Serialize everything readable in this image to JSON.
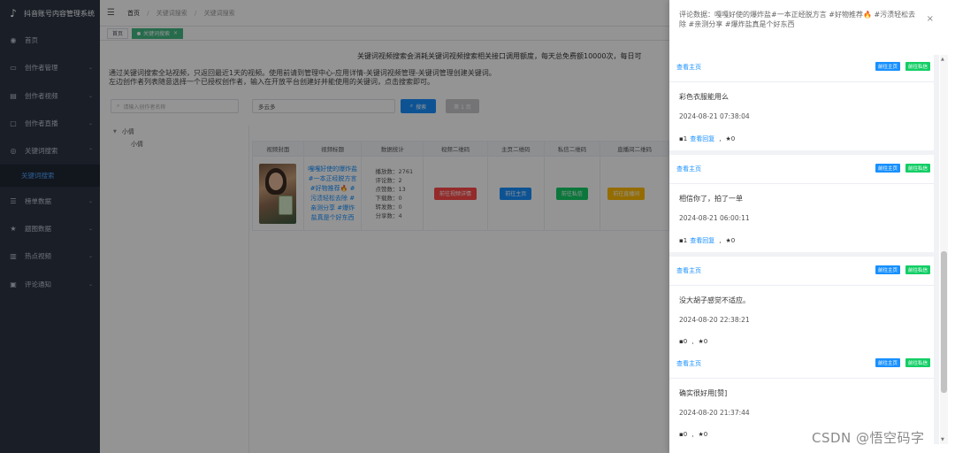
{
  "sidebar": {
    "brand": "抖音账号内容管理系统",
    "items": [
      {
        "label": "首页",
        "icon": "dashboard-icon"
      },
      {
        "label": "创作者管理",
        "icon": "monitor-icon"
      },
      {
        "label": "创作者视频",
        "icon": "document-icon"
      },
      {
        "label": "创作者直播",
        "icon": "live-icon"
      },
      {
        "label": "关键词搜索",
        "icon": "eye-icon"
      },
      {
        "label": "关键词搜索",
        "icon": "",
        "sub": true
      },
      {
        "label": "榜单数据",
        "icon": "list-icon"
      },
      {
        "label": "题图数据",
        "icon": "star-icon"
      },
      {
        "label": "热点视频",
        "icon": "chart-icon"
      },
      {
        "label": "评论通知",
        "icon": "message-icon"
      }
    ]
  },
  "header": {
    "breadcrumb": [
      "首页",
      "关键词搜索",
      "关键词搜索"
    ]
  },
  "tags": [
    {
      "label": "首页",
      "active": false
    },
    {
      "label": "关键词搜索",
      "active": true
    }
  ],
  "main": {
    "notice": "关键词视频搜索会消耗关键词视频搜索相关接口调用额度，每天总免费额10000次，每日可",
    "intro_line1": "通过关键词搜索全站视频，只返回最近1天的视频。使用前请到管理中心-应用详情-关键词视频管理-关键词管理创建关键词。",
    "intro_line2": "左边创作者列表随意选择一个已授权创作者，输入在开放平台创建好并能使用的关键词，点击搜索即可。",
    "creator_search_placeholder": "请输入创作者名称",
    "keyword_value": "多云多",
    "search_btn": "搜索",
    "page_btn": "第 1 页",
    "tree": {
      "parent": "小倩",
      "child": "小倩"
    },
    "table": {
      "headers": [
        "视频封面",
        "视频标题",
        "数据统计",
        "视频二维码",
        "主页二维码",
        "私信二维码",
        "直播间二维码"
      ],
      "row": {
        "title": "嘎嘎好使的爆炸盐#一本正经脱方言#好物推荐🔥 #污渍轻松去除 #亲测分享 #爆炸盐真是个好东西",
        "stats": [
          "播放数：2761",
          "评论数：2",
          "点赞数：13",
          "下载数：0",
          "转发数：0",
          "分享数：4"
        ],
        "btn_video": "前往视频详情",
        "btn_home": "前往主页",
        "btn_msg": "前往私信",
        "btn_live": "前往直播间"
      }
    }
  },
  "drawer": {
    "title": "评论数据：嘎嘎好使的爆炸盐#一本正经脱方言 #好物推荐🔥 #污渍轻松去除 #亲测分享 #爆炸盐真是个好东西",
    "close": "×",
    "home_label": "查看主页",
    "tag_home": "前往主页",
    "tag_msg": "前往私信",
    "comments": [
      {
        "content": "彩色衣服能用么",
        "time": "2024-08-21 07:38:04",
        "replies": "1",
        "reply_link": "查看回复",
        "stars": "★0"
      },
      {
        "content": "相信你了，拍了一单",
        "time": "2024-08-21 06:00:11",
        "replies": "1",
        "reply_link": "查看回复",
        "stars": "★0"
      },
      {
        "content": "没大胡子感觉不适应。",
        "time": "2024-08-20 22:38:21",
        "replies": "0",
        "reply_link": "",
        "stars": "★0"
      },
      {
        "content": "确实很好用[赞]",
        "time": "2024-08-20 21:37:44",
        "replies": "0",
        "reply_link": "",
        "stars": "★0"
      }
    ]
  },
  "watermark": "CSDN @悟空码字",
  "colors": {
    "primary": "#1890ff",
    "success": "#13ce66",
    "danger": "#ff4949",
    "warning": "#ffba00",
    "sidebar": "#2b3444"
  }
}
